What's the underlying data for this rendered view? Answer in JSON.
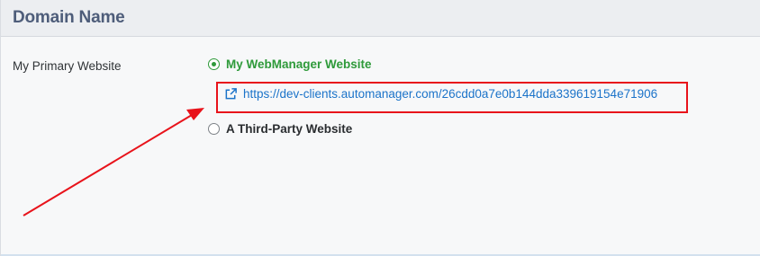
{
  "panel": {
    "title": "Domain Name"
  },
  "field": {
    "label": "My Primary Website"
  },
  "options": {
    "primary": {
      "label": "My WebManager Website",
      "selected": true
    },
    "third_party": {
      "label": "A Third-Party Website",
      "selected": false
    }
  },
  "website_link": {
    "url": "https://dev-clients.automanager.com/26cdd0a7e0b144dda339619154e71906",
    "icon": "external-link-icon"
  },
  "annotation": {
    "arrow_color": "#e8131b",
    "box_color": "#e8131b"
  },
  "colors": {
    "selected_green": "#2e9a3a",
    "link_blue": "#1b73c9",
    "title_color": "#4e5d7a"
  }
}
